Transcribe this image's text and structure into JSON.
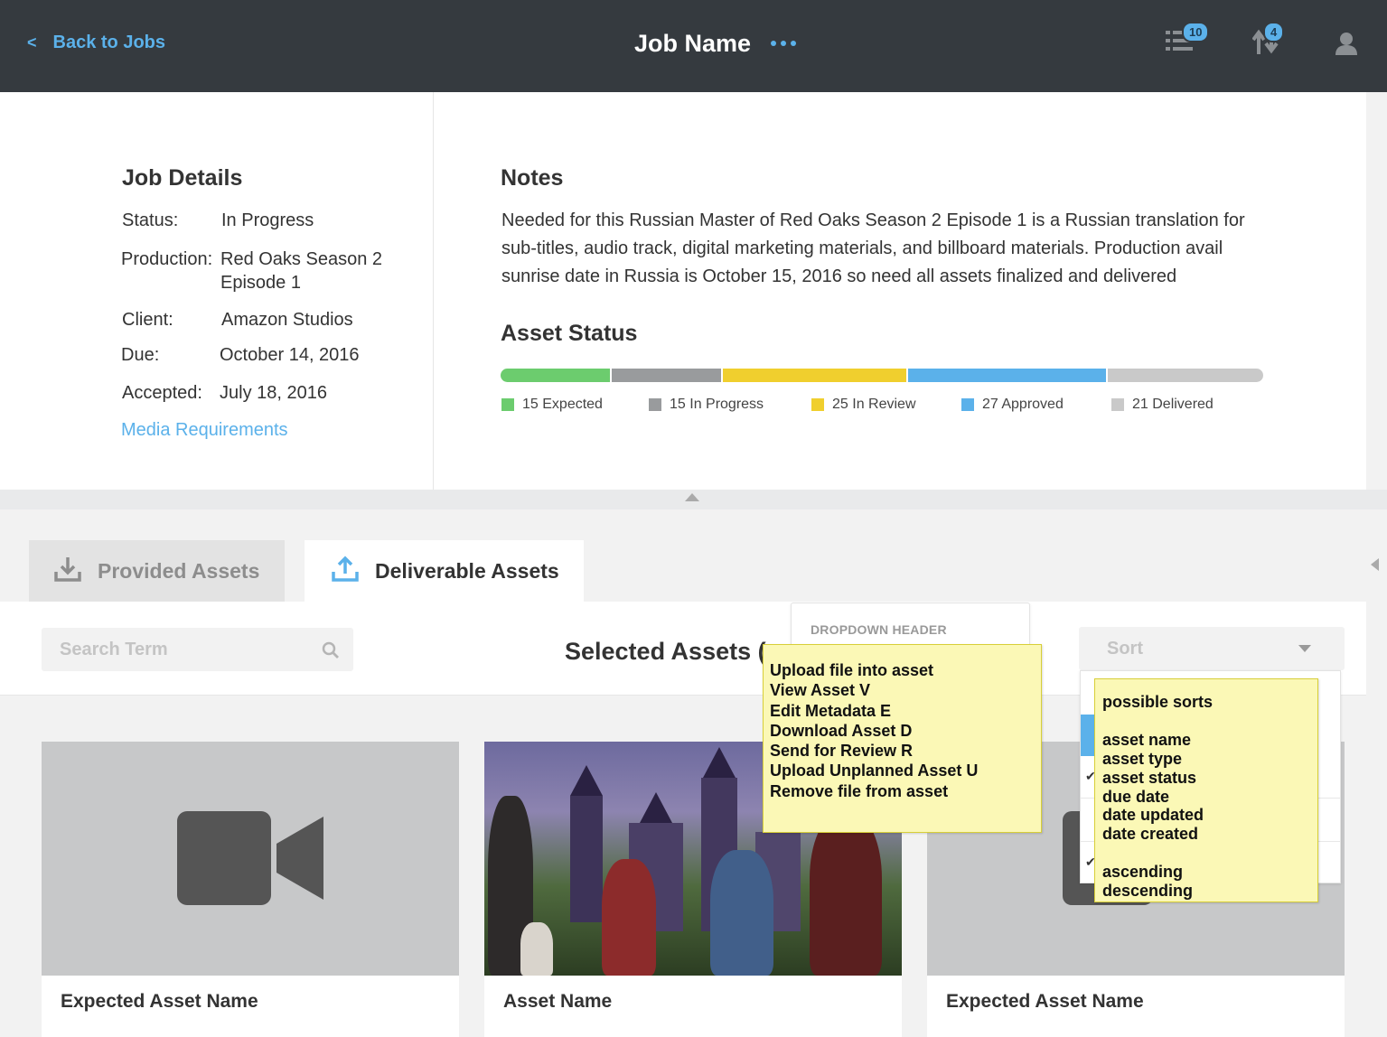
{
  "header": {
    "back_label": "Back to Jobs",
    "back_chevron": "<",
    "title": "Job Name",
    "tasks_badge": "10",
    "transfers_badge": "4",
    "icons": {
      "tasks": "task-list-icon",
      "transfers": "transfer-arrows-icon",
      "user": "user-avatar-icon",
      "more": "more-dots-icon"
    }
  },
  "job_details": {
    "heading": "Job Details",
    "rows": [
      {
        "label": "Status:",
        "value": "In Progress"
      },
      {
        "label": "Production:",
        "value": "Red Oaks Season 2",
        "value2": "Episode 1"
      },
      {
        "label": "Client:",
        "value": "Amazon Studios"
      },
      {
        "label": "Due:",
        "value": "October 14, 2016"
      },
      {
        "label": "Accepted:",
        "value": "July 18, 2016"
      }
    ],
    "media_link": "Media Requirements"
  },
  "notes": {
    "heading": "Notes",
    "text": "Needed for this Russian Master of Red Oaks Season 2 Episode 1 is a Russian translation for sub-titles, audio track, digital marketing materials, and billboard materials. Production avail sunrise date in Russia is October 15, 2016 so need all assets finalized and delivered"
  },
  "asset_status": {
    "heading": "Asset Status",
    "segments": [
      {
        "label": "15 Expected",
        "count": 15,
        "color": "#6ccc6e"
      },
      {
        "label": "15 In Progress",
        "count": 15,
        "color": "#999b9d"
      },
      {
        "label": "25 In Review",
        "count": 25,
        "color": "#f0cf2e"
      },
      {
        "label": "27 Approved",
        "count": 27,
        "color": "#5bb1ea"
      },
      {
        "label": "21 Delivered",
        "count": 21,
        "color": "#c9c9c9"
      }
    ]
  },
  "tabs": [
    {
      "label": "Provided Assets",
      "icon": "download-icon",
      "active": false
    },
    {
      "label": "Deliverable Assets",
      "icon": "upload-icon",
      "active": true
    }
  ],
  "toolbar": {
    "search_placeholder": "Search Term",
    "selected_title": "Selected Assets (",
    "sort_label": "Sort"
  },
  "actions_dropdown": {
    "header": "DROPDOWN HEADER",
    "items": [
      "Upload file into asset",
      "View Asset V",
      "Edit Metadata E",
      "Download Asset D",
      "Send for Review R",
      "Upload Unplanned Asset U",
      "Remove file from asset"
    ]
  },
  "sort_dropdown": {
    "lines": [
      "possible sorts",
      "",
      "asset name",
      "asset type",
      "asset status",
      "due date",
      "date updated",
      "date created",
      "",
      "ascending",
      "descending"
    ]
  },
  "cards": [
    {
      "name": "Expected Asset Name",
      "thumb": "video-camera-icon"
    },
    {
      "name": "Asset Name",
      "thumb": "scene-photo"
    },
    {
      "name": "Expected Asset Name",
      "thumb": "video-camera-icon"
    }
  ],
  "colors": {
    "accent": "#5bb1ea",
    "header_bg": "#353a3f",
    "sticky_bg": "#fbf8b6"
  }
}
